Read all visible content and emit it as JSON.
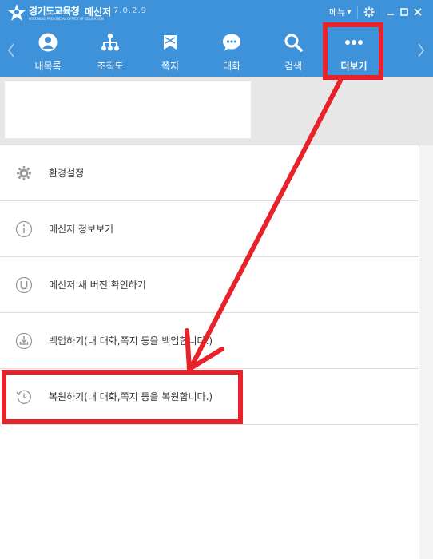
{
  "titlebar": {
    "brand": "경기도교육청",
    "brand_sub": "GYEONGGI PROVINCIAL OFFICE OF EDUCATION",
    "app_name": "메신저",
    "version": "7.0.2.9",
    "menu_label": "메뉴",
    "icons": [
      "logo-icon",
      "caret-down-icon",
      "gear-icon",
      "minimize-icon",
      "maximize-icon",
      "close-icon"
    ]
  },
  "nav": {
    "left_arrow": "chevron-left-icon",
    "right_arrow": "chevron-right-icon",
    "items": [
      {
        "label": "내목록",
        "icon": "person-icon"
      },
      {
        "label": "조직도",
        "icon": "org-chart-icon"
      },
      {
        "label": "쪽지",
        "icon": "note-icon"
      },
      {
        "label": "대화",
        "icon": "chat-icon"
      },
      {
        "label": "검색",
        "icon": "search-icon"
      },
      {
        "label": "더보기",
        "icon": "more-icon"
      }
    ],
    "active_index": 5
  },
  "menu": {
    "items": [
      {
        "label": "환경설정",
        "icon": "gear-icon"
      },
      {
        "label": "메신저 정보보기",
        "icon": "info-icon"
      },
      {
        "label": "메신저 새 버전 확인하기",
        "icon": "update-icon"
      },
      {
        "label": "백업하기(내 대화,쪽지 등을 백업합니다.)",
        "icon": "backup-icon"
      },
      {
        "label": "복원하기(내 대화,쪽지 등을 복원합니다.)",
        "icon": "restore-icon"
      }
    ]
  },
  "colors": {
    "header_blue": "#3d92da",
    "annotation_red": "#e8222a",
    "profile_bg": "#e7e7e7"
  }
}
